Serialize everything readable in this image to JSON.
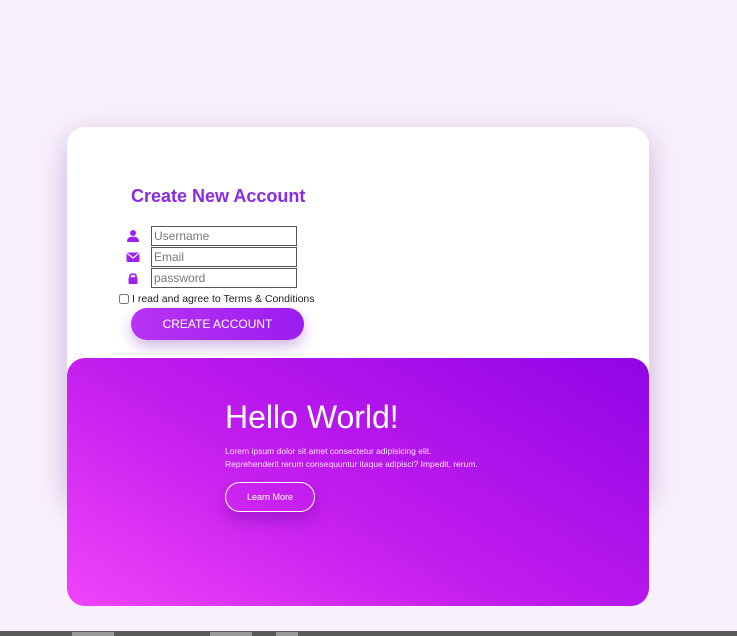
{
  "form": {
    "title": "Create New Account",
    "fields": [
      {
        "icon": "user-icon",
        "placeholder": "Username",
        "value": ""
      },
      {
        "icon": "envelope-icon",
        "placeholder": "Email",
        "value": ""
      },
      {
        "icon": "lock-icon",
        "placeholder": "password",
        "value": ""
      }
    ],
    "terms_label": "I read and agree to Terms & Conditions",
    "terms_checked": false,
    "submit_label": "CREATE ACCOUNT"
  },
  "hero": {
    "title": "Hello World!",
    "text_line1": "Lorem ipsum dolor sit amet consectetur adipisicing elit.",
    "text_line2": "Reprehenderit rerum consequuntur itaque adipisci? Impedit, rerum.",
    "button_label": "Learn More"
  },
  "colors": {
    "page_background": "#f8f1fc",
    "accent": "#8a2be2",
    "icon": "#a020f0",
    "button_gradient_start": "#b833f2",
    "button_gradient_end": "#9b1cf0",
    "hero_gradient_start": "#f044fa",
    "hero_gradient_end": "#9005e6"
  }
}
